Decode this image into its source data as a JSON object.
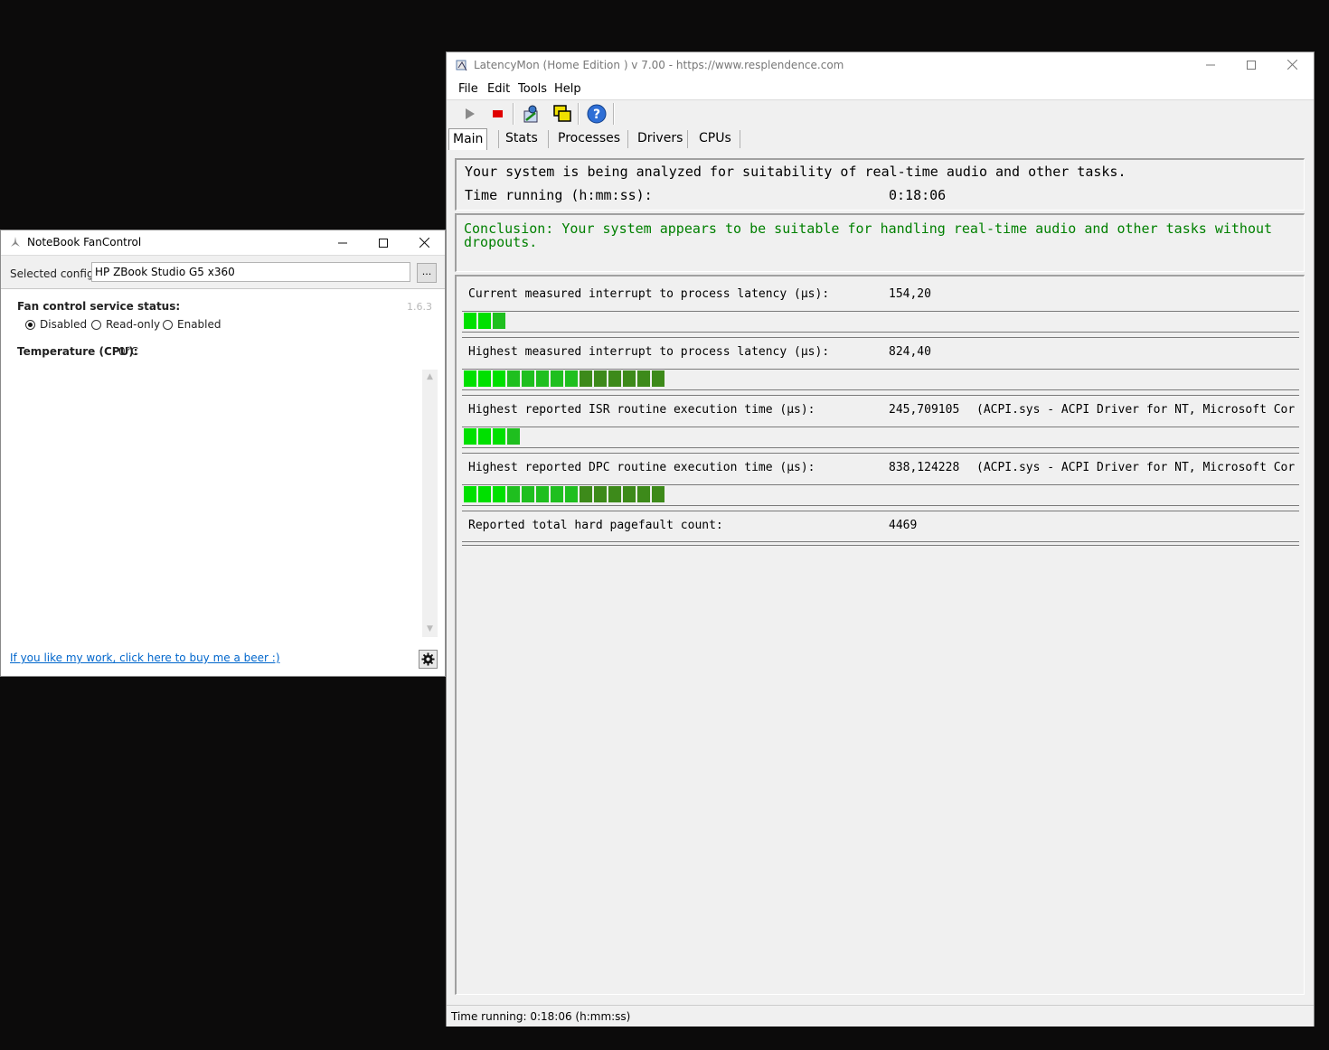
{
  "nbfc": {
    "title": "NoteBook FanControl",
    "config_label": "Selected config:",
    "config_value": "HP ZBook Studio G5 x360",
    "browse_label": "...",
    "version": "1.6.3",
    "status_label": "Fan control service status:",
    "radio": [
      {
        "label": "Disabled",
        "selected": true
      },
      {
        "label": "Read-only",
        "selected": false
      },
      {
        "label": "Enabled",
        "selected": false
      }
    ],
    "temp_label": "Temperature (CPU):",
    "temp_value": "0°C",
    "link": "If you like my work, click here to buy me a beer :)"
  },
  "latencymon": {
    "title": "LatencyMon  (Home Edition )  v 7.00 - https://www.resplendence.com",
    "menu": [
      "File",
      "Edit",
      "Tools",
      "Help"
    ],
    "tabs": [
      "Main",
      "Stats",
      "Processes",
      "Drivers",
      "CPUs"
    ],
    "analysis_line": "Your system is being analyzed for suitability of real-time audio and other tasks.",
    "time_label": "Time running (h:mm:ss):",
    "time_value": "0:18:06",
    "conclusion_line1": "Conclusion: Your system appears to be suitable for handling real-time audio and other tasks without",
    "conclusion_line2": "dropouts.",
    "metrics": [
      {
        "label": "Current measured interrupt to process latency (µs):",
        "value": "154,20",
        "extra": "",
        "bar_segments": 3
      },
      {
        "label": "Highest measured interrupt to process latency (µs):",
        "value": "824,40",
        "extra": "",
        "bar_segments": 14
      },
      {
        "label": "Highest reported ISR routine execution time (µs):",
        "value": "245,709105",
        "extra": "(ACPI.sys - ACPI Driver for NT, Microsoft Cor",
        "bar_segments": 4
      },
      {
        "label": "Highest reported DPC routine execution time (µs):",
        "value": "838,124228",
        "extra": "(ACPI.sys - ACPI Driver for NT, Microsoft Cor",
        "bar_segments": 14
      },
      {
        "label": "Reported total hard pagefault count:",
        "value": "4469",
        "extra": "",
        "bar_segments": 0
      }
    ],
    "status": "Time running: 0:18:06  (h:mm:ss)",
    "colors": {
      "bar_bright": "#00e000",
      "bar_mid": "#1fbf1f",
      "bar_dark": "#3d8a1a",
      "conclusion": "#008000"
    }
  }
}
